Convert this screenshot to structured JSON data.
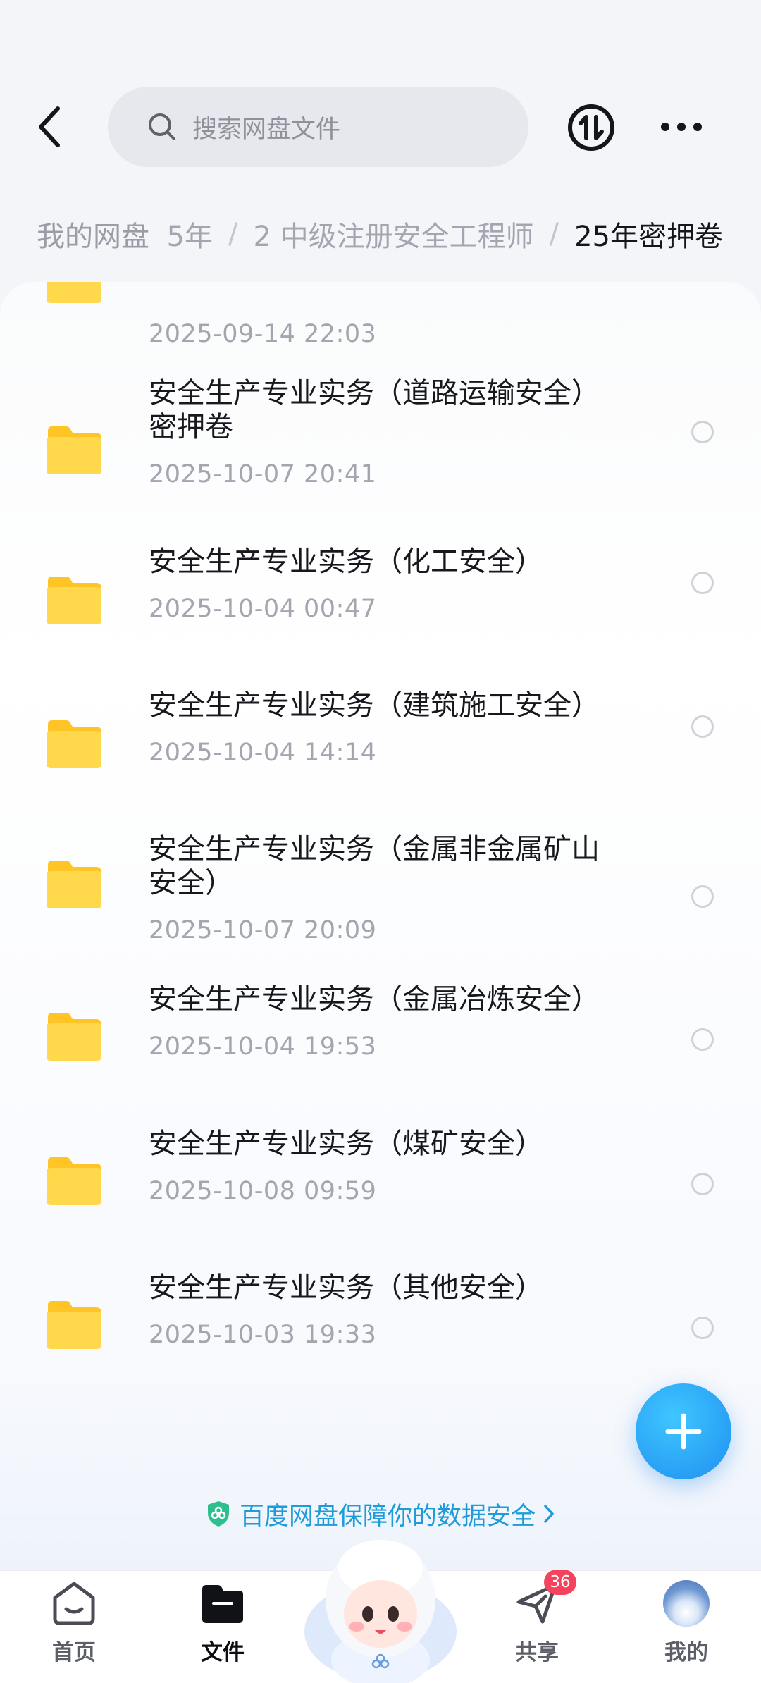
{
  "header": {
    "search_placeholder": "搜索网盘文件"
  },
  "breadcrumb": {
    "root": "我的网盘",
    "items": [
      "5年",
      "2 中级注册安全工程师",
      "25年密押卷"
    ],
    "separator": "/"
  },
  "files": [
    {
      "title": "",
      "date": "2025-09-14  22:03"
    },
    {
      "title": "安全生产专业实务（道路运输安全）\n密押卷",
      "date": "2025-10-07  20:41"
    },
    {
      "title": "安全生产专业实务（化工安全）",
      "date": "2025-10-04  00:47"
    },
    {
      "title": "安全生产专业实务（建筑施工安全）",
      "date": "2025-10-04  14:14"
    },
    {
      "title": "安全生产专业实务（金属非金属矿山\n安全）",
      "date": "2025-10-07  20:09"
    },
    {
      "title": "安全生产专业实务（金属冶炼安全）",
      "date": "2025-10-04  19:53"
    },
    {
      "title": "安全生产专业实务（煤矿安全）",
      "date": "2025-10-08  09:59"
    },
    {
      "title": "安全生产专业实务（其他安全）",
      "date": "2025-10-03  19:33"
    }
  ],
  "security_banner": "百度网盘保障你的数据安全",
  "nav": {
    "home": "首页",
    "files": "文件",
    "share": "共享",
    "share_badge": "36",
    "me": "我的"
  },
  "colors": {
    "accent": "#1f8ff0",
    "folder": "#ffd044",
    "badge": "#f5425d"
  },
  "icons": [
    "back-icon",
    "search-icon",
    "sort-icon",
    "more-icon",
    "folder-icon",
    "plus-icon",
    "shield-icon",
    "home-icon",
    "files-icon",
    "share-icon"
  ]
}
